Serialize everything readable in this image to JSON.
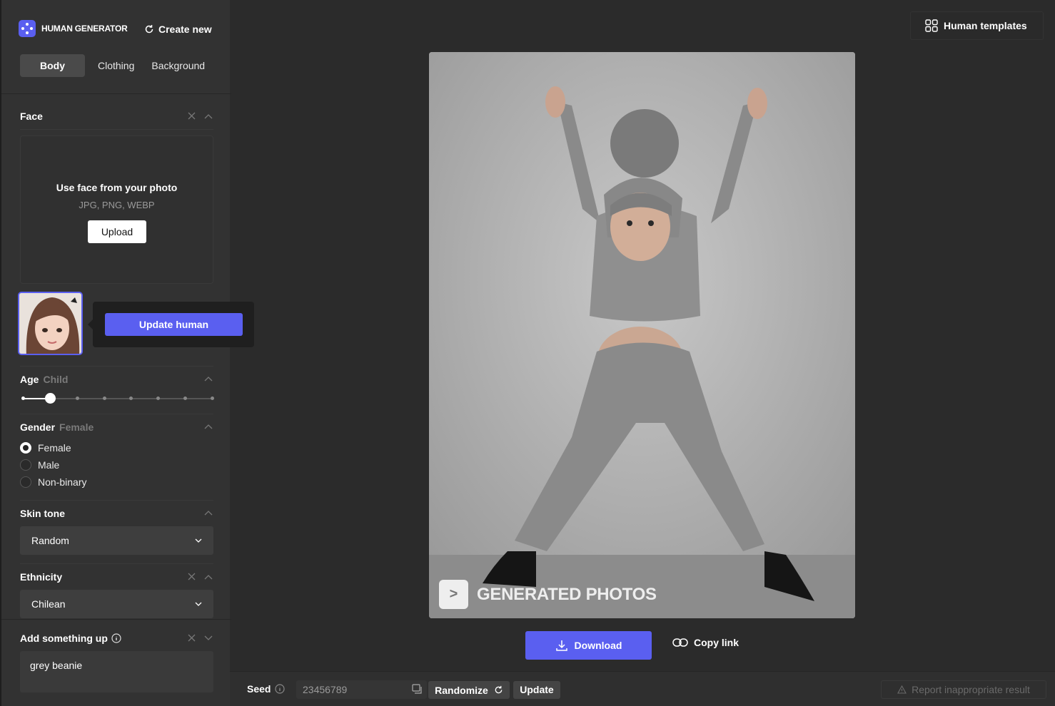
{
  "brand": {
    "name": "HUMAN GENERATOR"
  },
  "header": {
    "create_new": "Create new",
    "templates": "Human templates"
  },
  "tabs": [
    {
      "label": "Body"
    },
    {
      "label": "Clothing"
    },
    {
      "label": "Background"
    }
  ],
  "face": {
    "title": "Face",
    "upload_title": "Use face from your photo",
    "upload_formats": "JPG, PNG, WEBP",
    "upload_button": "Upload",
    "update_button": "Update human"
  },
  "age": {
    "title": "Age",
    "value": "Child",
    "step_index": 1,
    "step_count": 8
  },
  "gender": {
    "title": "Gender",
    "value": "Female",
    "options": [
      {
        "label": "Female",
        "selected": true
      },
      {
        "label": "Male",
        "selected": false
      },
      {
        "label": "Non-binary",
        "selected": false
      }
    ]
  },
  "skin_tone": {
    "title": "Skin tone",
    "value": "Random"
  },
  "ethnicity": {
    "title": "Ethnicity",
    "value": "Chilean"
  },
  "add_something": {
    "title": "Add something up",
    "value": "grey beanie"
  },
  "preview": {
    "watermark": "GENERATED PHOTOS"
  },
  "actions": {
    "download": "Download",
    "copy_link": "Copy link"
  },
  "bottom": {
    "seed_label": "Seed",
    "seed_value": "23456789",
    "randomize": "Randomize",
    "update": "Update",
    "report": "Report inappropriate result"
  },
  "colors": {
    "accent": "#5a5ff0",
    "background": "#2b2b2b",
    "sidebar": "#323232"
  },
  "icons": [
    "logo-icon",
    "refresh-icon",
    "close-icon",
    "chevron-up-icon",
    "chevron-down-icon",
    "info-icon",
    "grid-icon",
    "download-icon",
    "link-icon",
    "copy-icon",
    "warning-icon"
  ]
}
